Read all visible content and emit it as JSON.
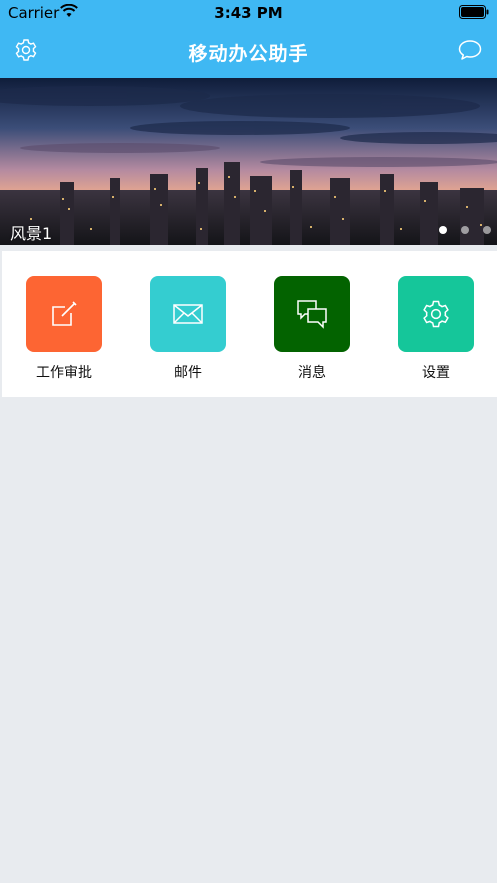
{
  "status_bar": {
    "carrier": "Carrier",
    "time": "3:43 PM"
  },
  "nav": {
    "title": "移动办公助手",
    "left_icon": "settings-gear-icon",
    "right_icon": "chat-bubble-icon"
  },
  "banner": {
    "caption": "风景1",
    "page_count": 3,
    "active_page": 1
  },
  "grid": {
    "items": [
      {
        "label": "工作审批",
        "icon": "edit-icon",
        "color": "#fd6533"
      },
      {
        "label": "邮件",
        "icon": "mail-icon",
        "color": "#34cdd0"
      },
      {
        "label": "消息",
        "icon": "messages-icon",
        "color": "#036300"
      },
      {
        "label": "设置",
        "icon": "gear-icon",
        "color": "#15c69a"
      }
    ]
  },
  "colors": {
    "nav_background": "#3fb8f3",
    "page_background": "#e8ebef"
  }
}
